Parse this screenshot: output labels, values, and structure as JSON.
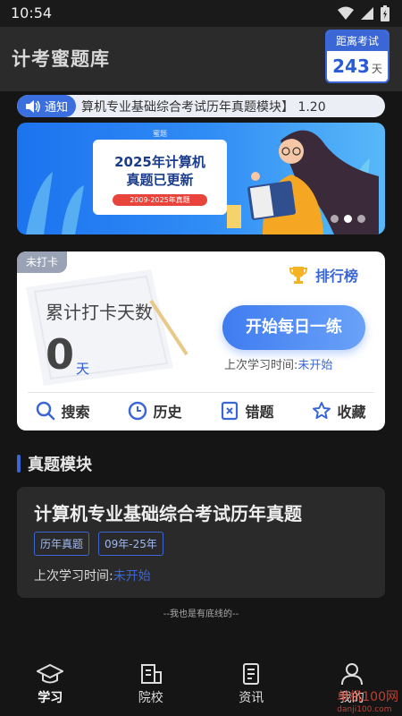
{
  "status_bar": {
    "time": "10:54"
  },
  "header": {
    "title": "计考蜜题库"
  },
  "countdown": {
    "label": "距离考试",
    "days": "243",
    "unit": "天"
  },
  "notice": {
    "tag": "通知",
    "text": "算机专业基础综合考试历年真题模块】 1.20"
  },
  "banner": {
    "small_text": "蜜题",
    "title_line1": "2025年计算机",
    "title_line2": "真题已更新",
    "range": "2009-2025年真题",
    "slides": 3,
    "active_slide": 1
  },
  "checkin": {
    "tag": "未打卡",
    "cumulative_label": "累计打卡天数",
    "cumulative_days": "0",
    "days_unit": "天",
    "ranking_label": "排行榜",
    "start_button": "开始每日一练",
    "last_study_label": "上次学习时间:",
    "last_study_value": "未开始",
    "actions": [
      {
        "label": "搜索",
        "icon": "search-icon"
      },
      {
        "label": "历史",
        "icon": "clock-icon"
      },
      {
        "label": "错题",
        "icon": "wrong-icon"
      },
      {
        "label": "收藏",
        "icon": "star-icon"
      }
    ]
  },
  "section": {
    "title": "真题模块"
  },
  "module": {
    "title": "计算机专业基础综合考试历年真题",
    "tags": [
      "历年真题",
      "09年-25年"
    ],
    "last_study_label": "上次学习时间:",
    "last_study_value": "未开始"
  },
  "footer_line": "--我也是有底线的--",
  "tabs": [
    {
      "label": "学习",
      "icon": "graduation-cap-icon",
      "active": true
    },
    {
      "label": "院校",
      "icon": "building-icon",
      "active": false
    },
    {
      "label": "资讯",
      "icon": "document-icon",
      "active": false
    },
    {
      "label": "我的",
      "icon": "person-icon",
      "active": false
    }
  ],
  "watermark": {
    "line1": "单机100网",
    "line2": "danji100.com"
  },
  "colors": {
    "accent": "#3a66d6",
    "background": "#151515",
    "header": "#2b2b2b"
  }
}
